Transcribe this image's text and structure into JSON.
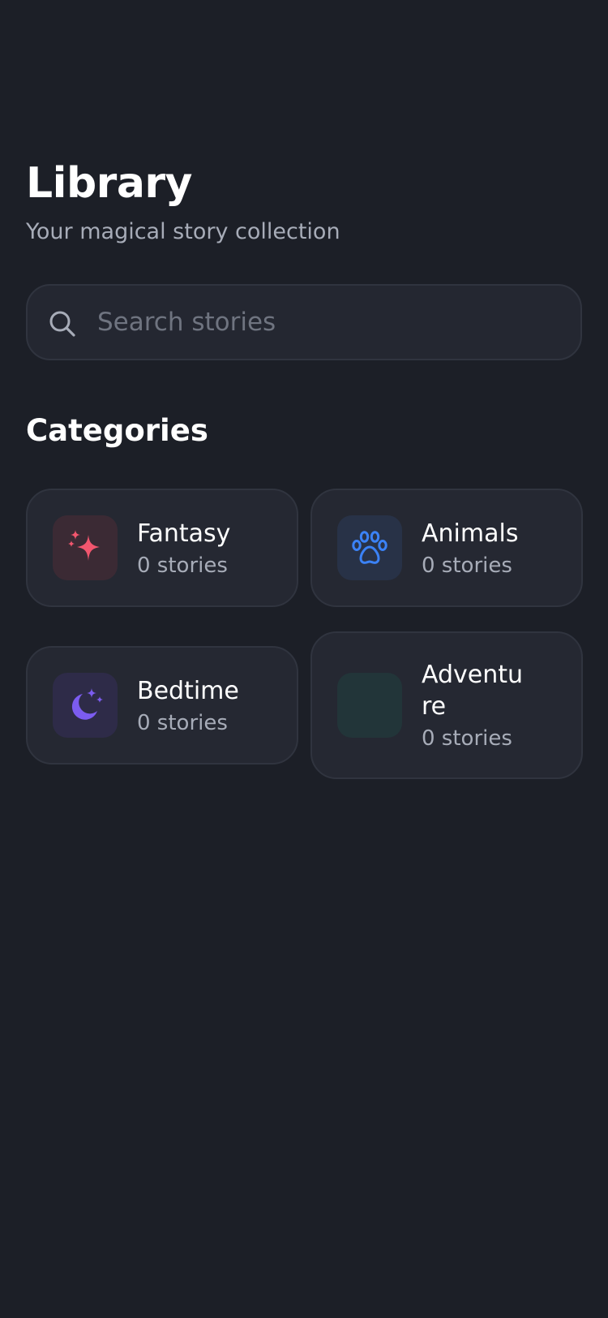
{
  "header": {
    "title": "Library",
    "subtitle": "Your magical story collection"
  },
  "search": {
    "placeholder": "Search stories",
    "value": "",
    "icon": "search-icon"
  },
  "categories": {
    "heading": "Categories",
    "items": [
      {
        "name": "Fantasy",
        "count": "0 stories",
        "icon": "sparkles-icon",
        "color": "#f2566e",
        "bg": "#3b2a34"
      },
      {
        "name": "Animals",
        "count": "0 stories",
        "icon": "paw-icon",
        "color": "#3b82f6",
        "bg": "#283247"
      },
      {
        "name": "Bedtime",
        "count": "0 stories",
        "icon": "moon-stars-icon",
        "color": "#7c5cf0",
        "bg": "#2e2b48"
      },
      {
        "name": "Adventure",
        "count": "0 stories",
        "icon": "",
        "color": "",
        "bg": "#223539"
      }
    ]
  }
}
